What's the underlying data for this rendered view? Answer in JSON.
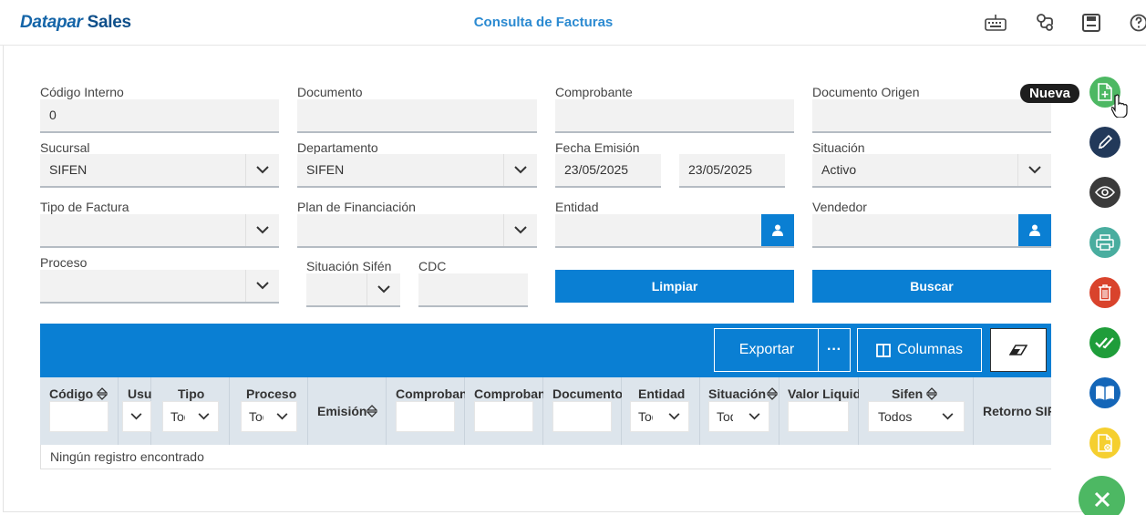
{
  "header": {
    "brand_part1": "Datapar",
    "brand_part2": "Sales",
    "title": "Consulta de Facturas",
    "icons": [
      "keyboard-icon",
      "route-icon",
      "save-icon",
      "help-icon"
    ]
  },
  "form": {
    "codigo_interno": {
      "label": "Código Interno",
      "value": "0"
    },
    "documento": {
      "label": "Documento",
      "value": ""
    },
    "comprobante": {
      "label": "Comprobante",
      "value": ""
    },
    "documento_origen": {
      "label": "Documento Origen",
      "value": ""
    },
    "sucursal": {
      "label": "Sucursal",
      "value": "SIFEN"
    },
    "departamento": {
      "label": "Departamento",
      "value": "SIFEN"
    },
    "fecha_emision": {
      "label": "Fecha Emisión",
      "from": "23/05/2025",
      "to": "23/05/2025"
    },
    "situacion": {
      "label": "Situación",
      "value": "Activo"
    },
    "tipo_factura": {
      "label": "Tipo de Factura",
      "value": ""
    },
    "plan_financiacion": {
      "label": "Plan de Financiación",
      "value": ""
    },
    "entidad": {
      "label": "Entidad",
      "value": ""
    },
    "vendedor": {
      "label": "Vendedor",
      "value": ""
    },
    "proceso": {
      "label": "Proceso",
      "value": ""
    },
    "situacion_sifen": {
      "label": "Situación Sifén",
      "value": ""
    },
    "cdc": {
      "label": "CDC",
      "value": ""
    },
    "limpiar_label": "Limpiar",
    "buscar_label": "Buscar"
  },
  "grid": {
    "toolbar": {
      "exportar_label": "Exportar",
      "more_label": "···",
      "columnas_label": "Columnas"
    },
    "columns": [
      {
        "title": "Código",
        "filter": ""
      },
      {
        "title": "Usua",
        "filter": ""
      },
      {
        "title": "Tipo",
        "filter": "Todos"
      },
      {
        "title": "Proceso",
        "filter": "Todos"
      },
      {
        "title": "Emisión",
        "filter": ""
      },
      {
        "title": "Comprobante",
        "filter": ""
      },
      {
        "title": "Comprobante",
        "filter": ""
      },
      {
        "title": "Documento",
        "filter": ""
      },
      {
        "title": "Entidad",
        "filter": "Todos"
      },
      {
        "title": "Situación",
        "filter": "Todos"
      },
      {
        "title": "Valor Liquido",
        "filter": ""
      },
      {
        "title": "Sifen",
        "filter": "Todos"
      },
      {
        "title": "Retorno SIFEN",
        "filter": ""
      }
    ],
    "empty_message": "Ningún registro encontrado"
  },
  "side_actions": {
    "tooltip": "Nueva",
    "buttons": [
      {
        "name": "new-document-icon",
        "color": "#4db863"
      },
      {
        "name": "edit-icon",
        "color": "#22395a"
      },
      {
        "name": "view-icon",
        "color": "#3b3b3b"
      },
      {
        "name": "print-icon",
        "color": "#49ad9f"
      },
      {
        "name": "delete-icon",
        "color": "#d9432c"
      },
      {
        "name": "approve-icon",
        "color": "#1f9d3a"
      },
      {
        "name": "book-icon",
        "color": "#1466b8"
      },
      {
        "name": "cancel-document-icon",
        "color": "#f5cf2f"
      }
    ],
    "close_color": "#4db863"
  },
  "colors": {
    "primary": "#0a7fd3",
    "title": "#2b8ad1",
    "header_row": "#dde5ec"
  }
}
